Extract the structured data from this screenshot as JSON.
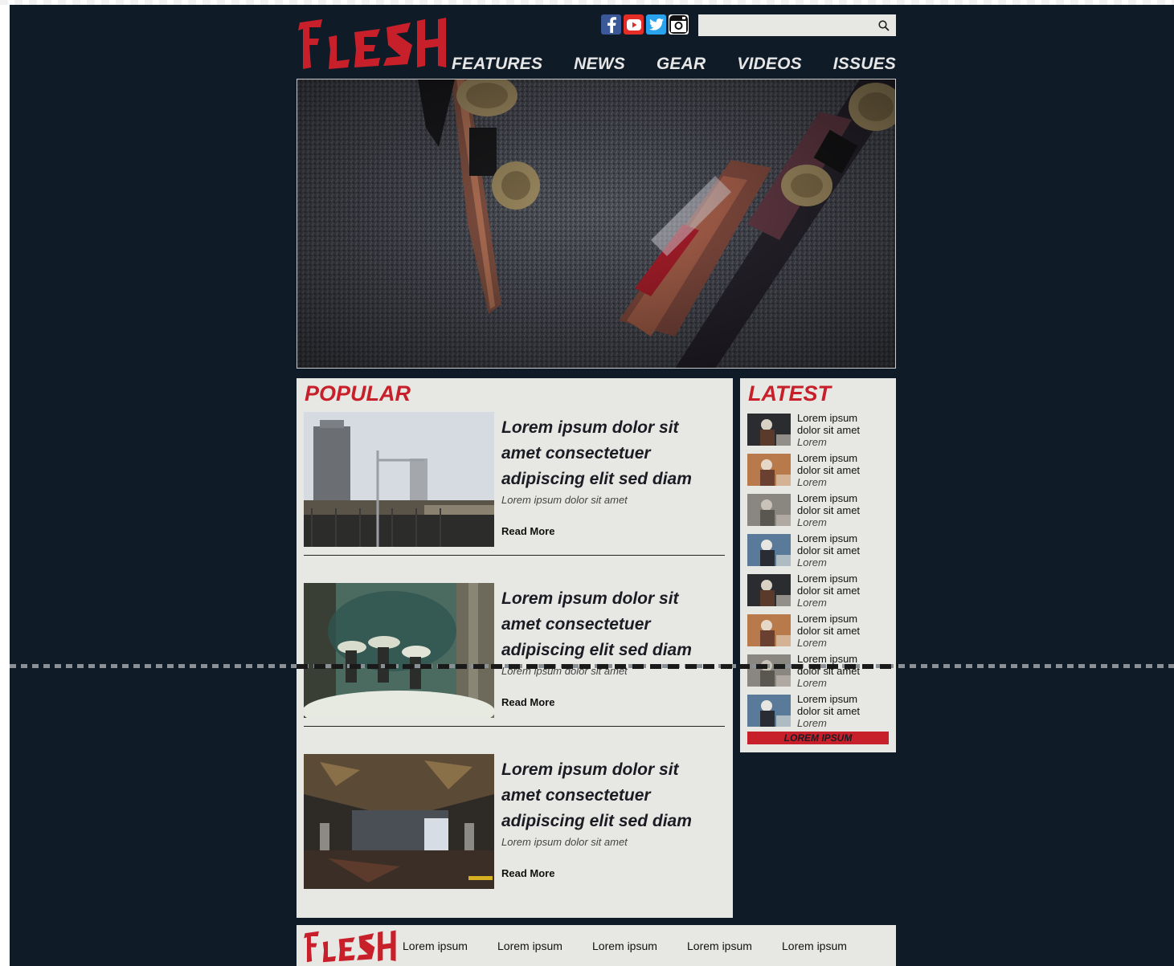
{
  "brand": {
    "logo_text": "FLESH",
    "accent": "#c8202a",
    "background": "#0f1b27",
    "panel": "#e7e8e3"
  },
  "social": [
    {
      "name": "facebook",
      "glyph": "f",
      "color": "#3b5998"
    },
    {
      "name": "youtube",
      "glyph": "▶",
      "color": "#e52d27"
    },
    {
      "name": "twitter",
      "glyph": "🐦",
      "color": "#2aa3ef"
    },
    {
      "name": "instagram",
      "glyph": "◉",
      "color": "#111111"
    }
  ],
  "search": {
    "placeholder": "",
    "icon": "search-icon"
  },
  "nav": [
    "FEATURES",
    "NEWS",
    "GEAR",
    "VIDEOS",
    "ISSUES"
  ],
  "popular": {
    "title": "POPULAR",
    "articles": [
      {
        "headline": "Lorem ipsum dolor sit amet consectetuer adipiscing elit sed diam",
        "sub": "Lorem ipsum dolor sit amet",
        "more": "Read More"
      },
      {
        "headline": "Lorem ipsum dolor sit amet consectetuer adipiscing elit sed diam",
        "sub": "Lorem ipsum dolor sit amet",
        "more": "Read More"
      },
      {
        "headline": "Lorem ipsum dolor sit amet consectetuer adipiscing elit sed diam",
        "sub": "Lorem ipsum dolor sit amet",
        "more": "Read More"
      }
    ]
  },
  "latest": {
    "title": "LATEST",
    "items": [
      {
        "line1": "Lorem ipsum",
        "line2": "dolor sit amet",
        "meta": "Lorem"
      },
      {
        "line1": "Lorem ipsum",
        "line2": "dolor sit amet",
        "meta": "Lorem"
      },
      {
        "line1": "Lorem ipsum",
        "line2": "dolor sit amet",
        "meta": "Lorem"
      },
      {
        "line1": "Lorem ipsum",
        "line2": "dolor sit amet",
        "meta": "Lorem"
      },
      {
        "line1": "Lorem ipsum",
        "line2": "dolor sit amet",
        "meta": "Lorem"
      },
      {
        "line1": "Lorem ipsum",
        "line2": "dolor sit amet",
        "meta": "Lorem"
      },
      {
        "line1": "Lorem ipsum",
        "line2": "dolor sit amet",
        "meta": "Lorem"
      },
      {
        "line1": "Lorem ipsum",
        "line2": "dolor sit amet",
        "meta": "Lorem"
      }
    ],
    "button": "LOREM IPSUM"
  },
  "footer": {
    "links": [
      "Lorem ipsum",
      "Lorem ipsum",
      "Lorem ipsum",
      "Lorem ipsum",
      "Lorem ipsum"
    ]
  }
}
